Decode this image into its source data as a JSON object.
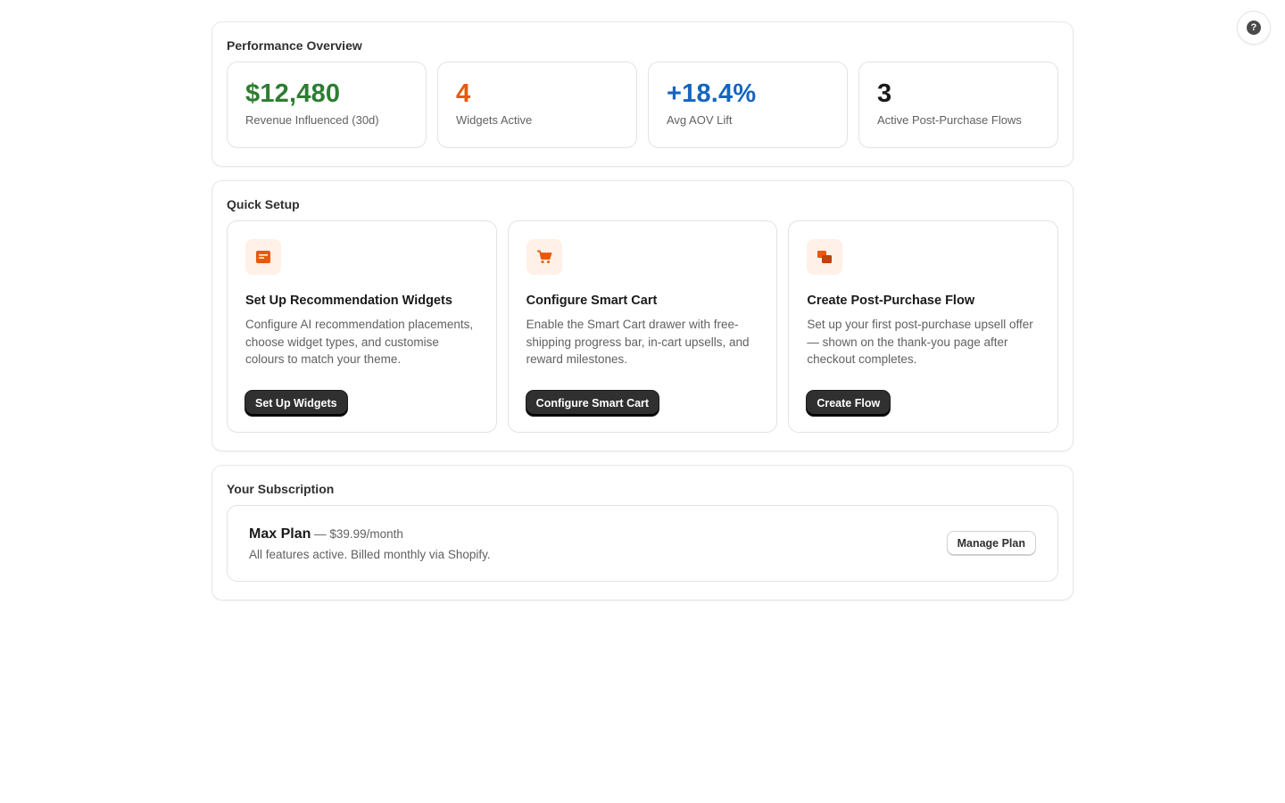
{
  "help": {
    "icon": "question-circle-icon",
    "glyph": "?"
  },
  "overview": {
    "title": "Performance Overview",
    "stats": [
      {
        "value": "$12,480",
        "label": "Revenue Influenced (30d)",
        "color": "#2e7d32"
      },
      {
        "value": "4",
        "label": "Widgets Active",
        "color": "#e8590c"
      },
      {
        "value": "+18.4%",
        "label": "Avg AOV Lift",
        "color": "#1565c0"
      },
      {
        "value": "3",
        "label": "Active Post-Purchase Flows",
        "color": "#1a1a1a"
      }
    ]
  },
  "quick_setup": {
    "title": "Quick Setup",
    "items": [
      {
        "icon": "widget-layout-icon",
        "title": "Set Up Recommendation Widgets",
        "description": "Configure AI recommendation placements, choose widget types, and customise colours to match your theme.",
        "button": "Set Up Widgets"
      },
      {
        "icon": "cart-icon",
        "title": "Configure Smart Cart",
        "description": "Enable the Smart Cart drawer with free-shipping progress bar, in-cart upsells, and reward milestones.",
        "button": "Configure Smart Cart"
      },
      {
        "icon": "duplicate-icon",
        "title": "Create Post-Purchase Flow",
        "description": "Set up your first post-purchase upsell offer — shown on the thank-you page after checkout completes.",
        "button": "Create Flow"
      }
    ]
  },
  "subscription": {
    "title": "Your Subscription",
    "plan_name": "Max Plan",
    "plan_price": " — $39.99/month",
    "description": "All features active. Billed monthly via Shopify.",
    "button": "Manage Plan"
  },
  "colors": {
    "accent": "#e8590c",
    "icon_bg": "#fff0e8",
    "primary_button": "#303030"
  }
}
